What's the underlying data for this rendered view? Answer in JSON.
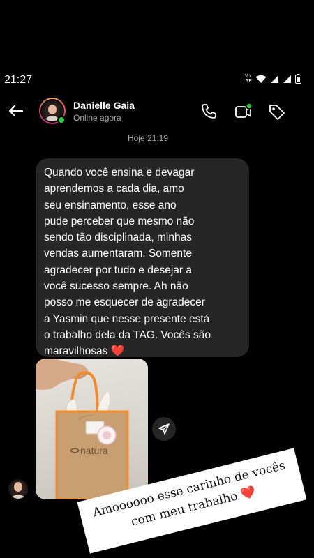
{
  "status_bar": {
    "time": "21:27",
    "volte_top": "Vo",
    "volte_bottom": "LTE"
  },
  "header": {
    "contact_name": "Danielle Gaia",
    "contact_status": "Online agora",
    "icons": [
      "back-arrow-icon",
      "phone-icon",
      "video-call-icon",
      "tag-icon"
    ]
  },
  "conversation": {
    "timestamp": "Hoje 21:19",
    "message_text": "Quando você ensina e devagar\naprendemos a cada dia, amo\nseu ensinamento, esse ano\npude perceber que mesmo não\nsendo tão disciplinada, minhas\nvendas aumentaram. Somente\nagradecer por tudo e desejar a\nvocê sucesso sempre. Ah não\nposso me esquecer de agradecer\na Yasmin que nesse presente está\no trabalho dela da TAG. Vocês são\nmaravilhosas ",
    "message_emoji": "❤️",
    "photo_bag_brand": "natura"
  },
  "overlay_note": {
    "text": "Amoooooo esse carinho de vocês\ncom meu trabalho ",
    "emoji": "❤️"
  },
  "colors": {
    "background": "#000000",
    "bubble": "#262626",
    "online": "#2ecc40",
    "bag_orange": "#f08a2b",
    "heart": "#e0242d"
  }
}
